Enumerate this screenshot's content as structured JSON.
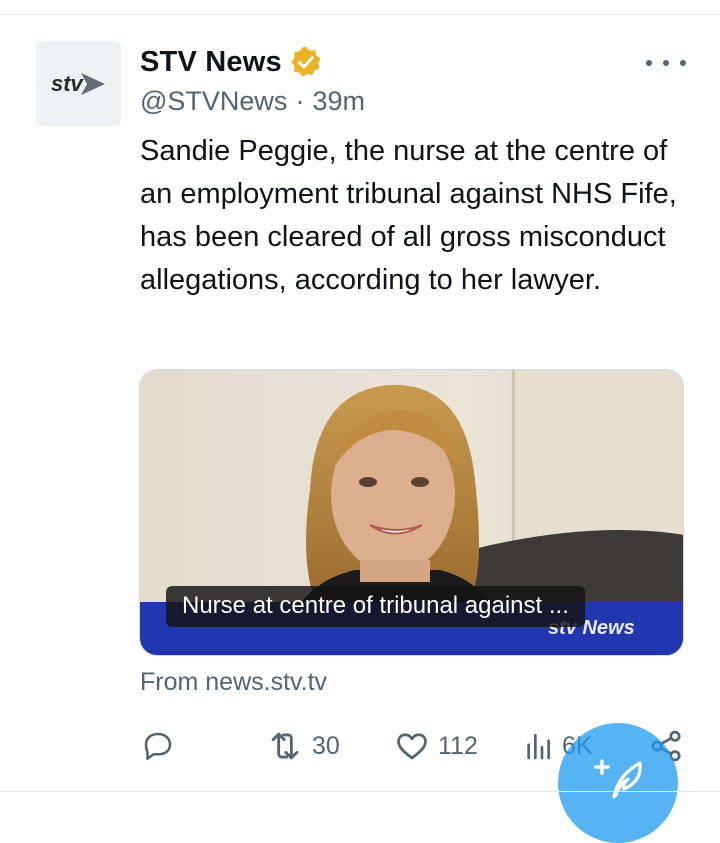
{
  "tweet": {
    "author": {
      "display_name": "STV News",
      "handle": "@STVNews",
      "verified": true,
      "avatar_logo_text": "stv"
    },
    "timestamp_separator": "·",
    "timestamp": "39m",
    "text": "Sandie Peggie, the nurse at the centre of an employment tribunal against NHS Fife, has been cleared of all gross misconduct allegations, according to her lawyer.",
    "card": {
      "caption": "Nurse at centre of tribunal against ...",
      "watermark_text": "stv News",
      "source": "From news.stv.tv"
    },
    "actions": {
      "reply_icon": "reply-icon",
      "retweets": "30",
      "likes": "112",
      "views": "6K",
      "share_icon": "share-icon"
    }
  },
  "compose_icon": "compose-feather-icon",
  "colors": {
    "text_primary": "#0f1419",
    "text_secondary": "#536471",
    "verified_gold": "#e8b326",
    "fab_blue": "#1d9bf0",
    "stv_blue": "#1f3fbf"
  }
}
